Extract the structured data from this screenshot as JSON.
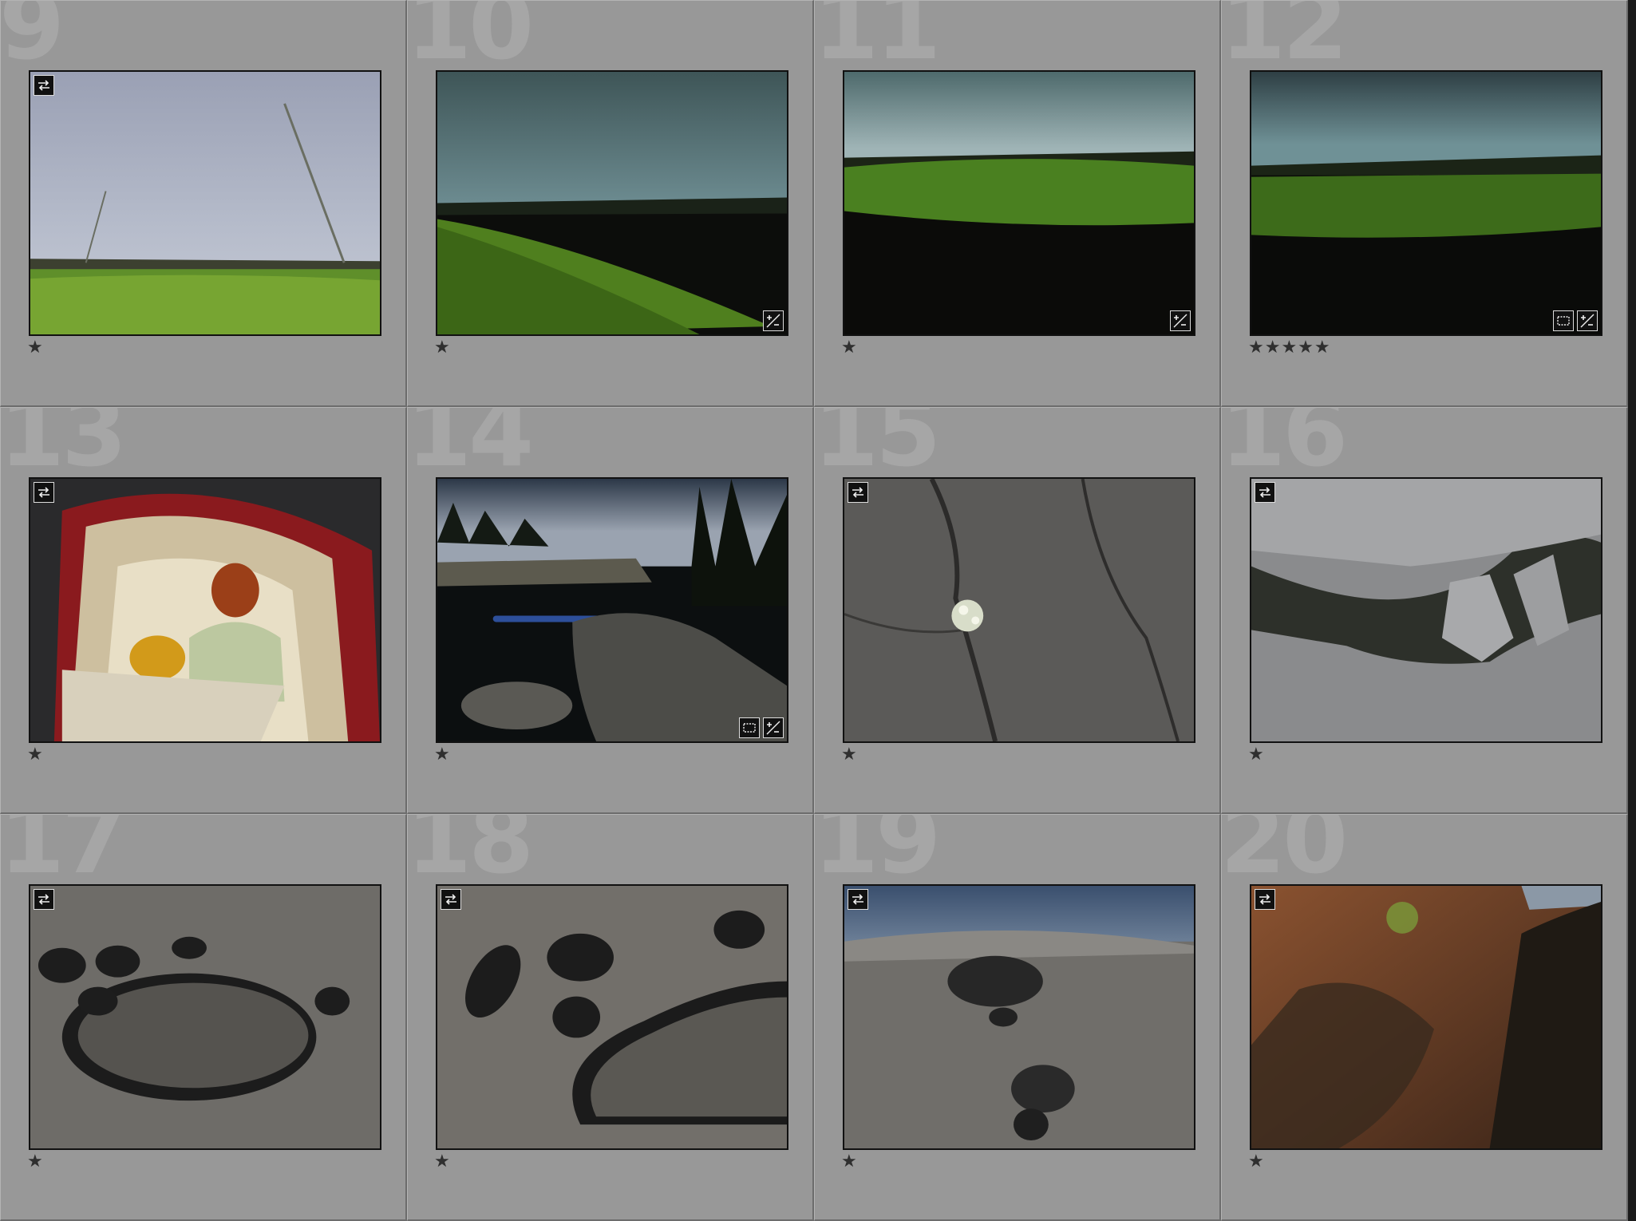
{
  "grid": {
    "cells": [
      {
        "index": "9",
        "rating_text": "★",
        "rating": 1,
        "scene": "meadow-sky",
        "badges": [
          "virtual-copy-icon"
        ]
      },
      {
        "index": "10",
        "rating_text": "★",
        "rating": 1,
        "scene": "field-rainbow",
        "badges": [
          "develop-icon"
        ]
      },
      {
        "index": "11",
        "rating_text": "★",
        "rating": 1,
        "scene": "grass-closeup",
        "badges": [
          "develop-icon"
        ]
      },
      {
        "index": "12",
        "rating_text": "★★★★★",
        "rating": 5,
        "scene": "field-dark",
        "badges": [
          "crop-icon",
          "develop-icon"
        ]
      },
      {
        "index": "13",
        "rating_text": "★",
        "rating": 1,
        "scene": "tent-girl",
        "badges": [
          "virtual-copy-icon"
        ]
      },
      {
        "index": "14",
        "rating_text": "★",
        "rating": 1,
        "scene": "lake-kayak",
        "badges": [
          "crop-icon",
          "develop-icon"
        ]
      },
      {
        "index": "15",
        "rating_text": "★",
        "rating": 1,
        "scene": "rock-flower",
        "badges": [
          "virtual-copy-icon"
        ]
      },
      {
        "index": "16",
        "rating_text": "★",
        "rating": 1,
        "scene": "rock-cracks",
        "badges": [
          "virtual-copy-icon"
        ]
      },
      {
        "index": "17",
        "rating_text": "★",
        "rating": 1,
        "scene": "rock-pools-a",
        "badges": [
          "virtual-copy-icon"
        ]
      },
      {
        "index": "18",
        "rating_text": "★",
        "rating": 1,
        "scene": "rock-pools-b",
        "badges": [
          "virtual-copy-icon"
        ]
      },
      {
        "index": "19",
        "rating_text": "★",
        "rating": 1,
        "scene": "rock-sea",
        "badges": [
          "virtual-copy-icon"
        ]
      },
      {
        "index": "20",
        "rating_text": "★",
        "rating": 1,
        "scene": "rock-orange",
        "badges": [
          "virtual-copy-icon"
        ]
      }
    ]
  },
  "colors": {
    "cell_background": "#989898",
    "index_text": "#a6a6a6",
    "rating_star": "#2f2f2f"
  }
}
